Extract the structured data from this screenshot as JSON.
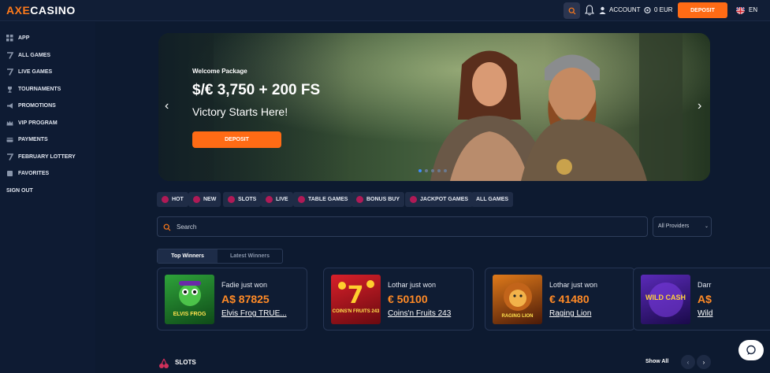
{
  "header": {
    "logo_prefix": "AXE",
    "logo_suffix": "CASINO",
    "account_label": "ACCOUNT",
    "balance": "0 EUR",
    "deposit_label": "DEPOSIT",
    "language": "EN"
  },
  "sidebar": {
    "items": [
      {
        "label": "APP",
        "icon": "grid-icon"
      },
      {
        "label": "ALL GAMES",
        "icon": "seven-icon"
      },
      {
        "label": "LIVE GAMES",
        "icon": "seven-icon"
      },
      {
        "label": "TOURNAMENTS",
        "icon": "trophy-icon"
      },
      {
        "label": "PROMOTIONS",
        "icon": "megaphone-icon"
      },
      {
        "label": "VIP PROGRAM",
        "icon": "crown-icon"
      },
      {
        "label": "PAYMENTS",
        "icon": "card-icon"
      },
      {
        "label": "FEBRUARY LOTTERY",
        "icon": "seven-icon"
      },
      {
        "label": "FAVORITES",
        "icon": "heart-icon"
      },
      {
        "label": "SIGN OUT",
        "icon": ""
      }
    ]
  },
  "banner": {
    "welcome": "Welcome Package",
    "headline": "$/€ 3,750 + 200 FS",
    "tagline": "Victory Starts Here!",
    "cta": "DEPOSIT",
    "slides": 5,
    "active_slide": 1
  },
  "categories": [
    {
      "label": "HOT"
    },
    {
      "label": "NEW"
    },
    {
      "label": "SLOTS"
    },
    {
      "label": "LIVE"
    },
    {
      "label": "TABLE GAMES"
    },
    {
      "label": "BONUS BUY"
    },
    {
      "label": "JACKPOT GAMES"
    },
    {
      "label": "ALL GAMES"
    }
  ],
  "search": {
    "placeholder": "Search",
    "providers_label": "All Providers"
  },
  "winners_tabs": {
    "active": "Top Winners",
    "inactive": "Latest Winners"
  },
  "winners": [
    {
      "who": "Fadie just won",
      "amount": "A$ 87825",
      "game": "Elvis Frog TRUE...",
      "thumb_text": "ELVIS FROG",
      "thumb_color": "#1d7a2a"
    },
    {
      "who": "Lothar just won",
      "amount": "€ 50100",
      "game": "Coins'n Fruits 243",
      "thumb_text": "COINS'N FRUITS 243",
      "thumb_color": "#b3141c"
    },
    {
      "who": "Lothar just won",
      "amount": "€ 41480",
      "game": "Raging Lion",
      "thumb_text": "RAGING LION",
      "thumb_color": "#7a2a10"
    },
    {
      "who": "Darr",
      "amount": "A$",
      "game": "Wild",
      "thumb_text": "WILD CASH",
      "thumb_color": "#3a1b7a"
    }
  ],
  "slots_section": {
    "title": "SLOTS",
    "show_all": "Show All"
  },
  "colors": {
    "accent": "#ff6b15",
    "background": "#0d1a30",
    "sidebar": "#0e1b33",
    "chip": "#1f2c46",
    "chip_icon": "#b01a56",
    "amount": "#ff8a26"
  }
}
